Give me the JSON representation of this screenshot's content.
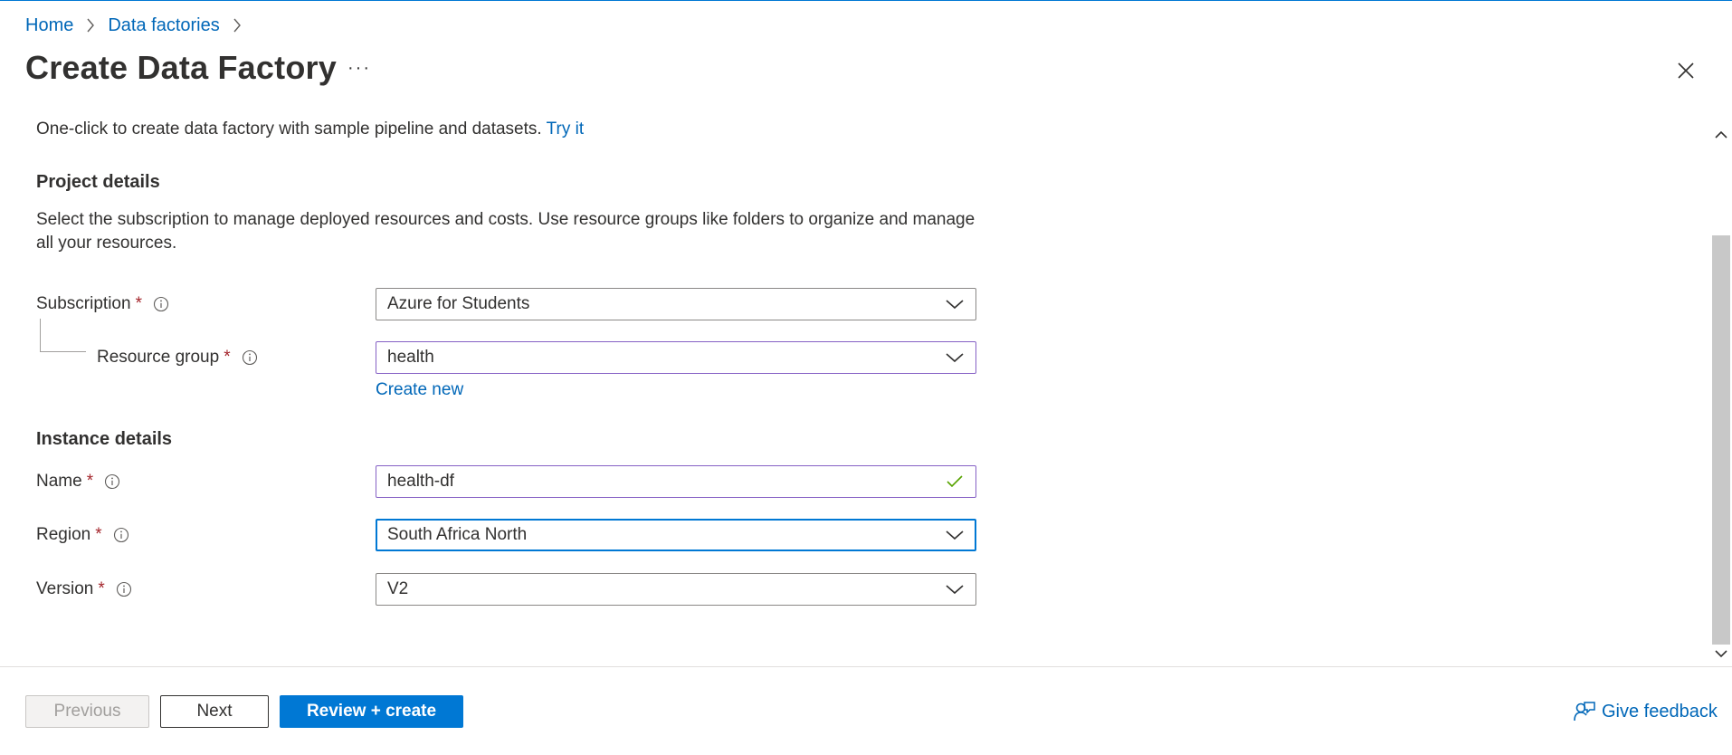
{
  "breadcrumb": {
    "items": [
      "Home",
      "Data factories"
    ]
  },
  "page": {
    "title": "Create Data Factory",
    "more_label": "···"
  },
  "intro": {
    "text": "One-click to create data factory with sample pipeline and datasets. ",
    "link": "Try it"
  },
  "project_details": {
    "heading": "Project details",
    "description": "Select the subscription to manage deployed resources and costs. Use resource groups like folders to organize and manage all your resources.",
    "subscription": {
      "label": "Subscription",
      "required_mark": "*",
      "value": "Azure for Students"
    },
    "resource_group": {
      "label": "Resource group",
      "required_mark": "*",
      "value": "health",
      "create_new": "Create new"
    }
  },
  "instance_details": {
    "heading": "Instance details",
    "name": {
      "label": "Name",
      "required_mark": "*",
      "value": "health-df"
    },
    "region": {
      "label": "Region",
      "required_mark": "*",
      "value": "South Africa North"
    },
    "version": {
      "label": "Version",
      "required_mark": "*",
      "value": "V2"
    }
  },
  "footer": {
    "previous": "Previous",
    "next": "Next",
    "review_create": "Review + create",
    "feedback": "Give feedback"
  },
  "colors": {
    "accent": "#0078d4",
    "link": "#0067b8",
    "required": "#a4262c",
    "valid_check": "#57a300",
    "validated_border": "#8661c5"
  },
  "icons": {
    "breadcrumb_separator": "chevron-right-icon",
    "close": "close-icon",
    "info": "info-icon",
    "dropdown": "chevron-down-icon",
    "valid": "checkmark-icon",
    "feedback": "feedback-person-icon"
  }
}
